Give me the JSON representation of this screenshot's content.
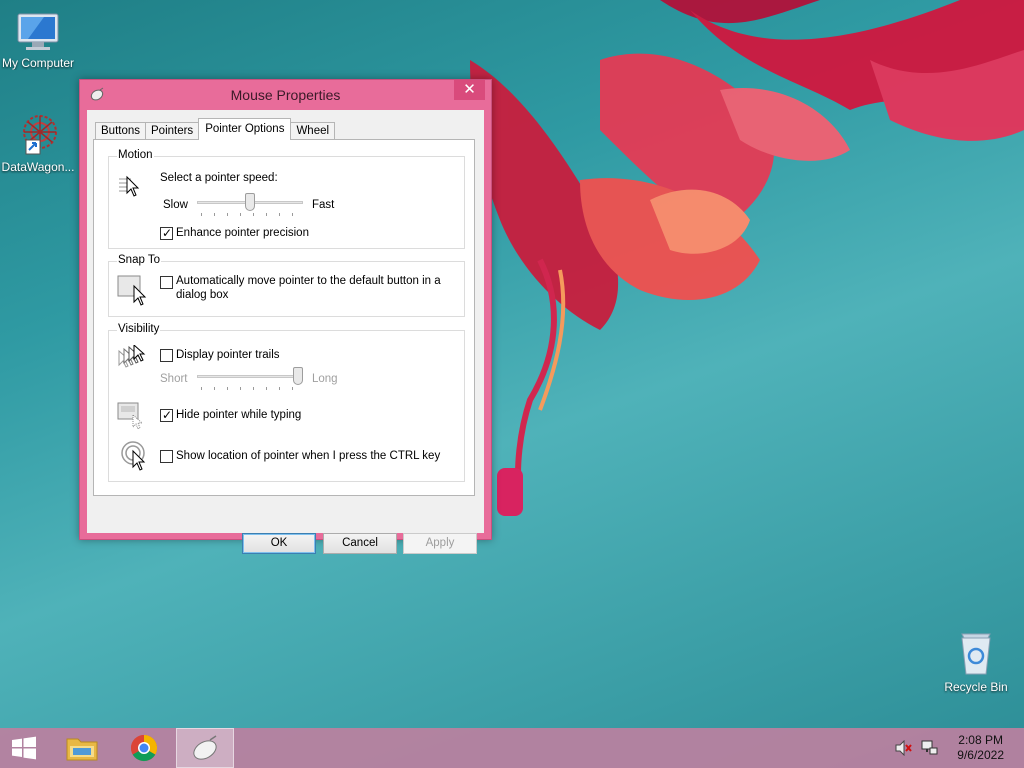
{
  "desktop": {
    "icons": [
      {
        "label": "My Computer"
      },
      {
        "label": "DataWagon..."
      },
      {
        "label": "Recycle Bin"
      }
    ]
  },
  "window": {
    "title": "Mouse Properties",
    "close_glyph": "✕",
    "tabs": [
      {
        "label": "Buttons",
        "active": false
      },
      {
        "label": "Pointers",
        "active": false
      },
      {
        "label": "Pointer Options",
        "active": true
      },
      {
        "label": "Wheel",
        "active": false
      }
    ],
    "motion": {
      "title": "Motion",
      "prompt": "Select a pointer speed:",
      "slow_label": "Slow",
      "fast_label": "Fast",
      "speed_level": 0.5,
      "enhance_label": "Enhance pointer precision",
      "enhance_checked": true
    },
    "snap_to": {
      "title": "Snap To",
      "auto_move_label": "Automatically move pointer to the default button in a dialog box",
      "auto_move_line1": "Automatically move pointer to the default button in a",
      "auto_move_line2": "dialog box",
      "auto_move_checked": false
    },
    "visibility": {
      "title": "Visibility",
      "trails_label": "Display pointer trails",
      "trails_checked": false,
      "short_label": "Short",
      "long_label": "Long",
      "trail_level": 1.0,
      "hide_label": "Hide pointer while typing",
      "hide_checked": true,
      "ctrl_label": "Show location of pointer when I press the CTRL key",
      "ctrl_checked": false
    },
    "buttons": {
      "ok": "OK",
      "cancel": "Cancel",
      "apply": "Apply"
    }
  },
  "taskbar": {
    "time": "2:08 PM",
    "date": "9/6/2022"
  },
  "colors": {
    "window_frame": "#e86c9a",
    "taskbar": "#bc80a0",
    "desktop": "#2f9aa3"
  }
}
